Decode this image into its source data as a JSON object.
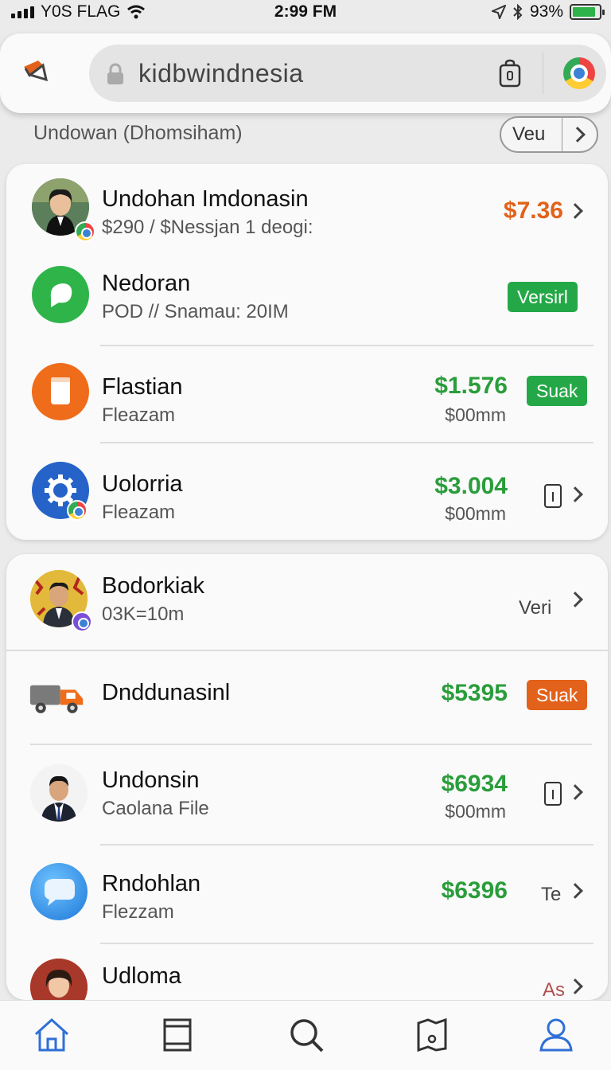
{
  "status_bar": {
    "carrier": "Y0S FLAG",
    "time": "2:99 FM",
    "battery": "93%"
  },
  "header": {
    "search_value": "kidbwindnesia",
    "icons": [
      "brand-icon",
      "lock-icon",
      "bag-icon",
      "chrome-icon"
    ]
  },
  "section": {
    "title": "Undowan (Dhomsiham)",
    "view_label": "Veu"
  },
  "card1": {
    "rows": [
      {
        "name": "Undohan Imdonasin",
        "sub": "$290 / $Nessjan 1 deogi:",
        "price": "$7.36"
      },
      {
        "name": "Nedoran",
        "sub": "POD // Snamau: 20IM",
        "badge": "Versirl"
      },
      {
        "name": "Flastian",
        "sub": "Fleazam",
        "price": "$1.576",
        "price_sub": "$00mm",
        "badge": "Suak"
      },
      {
        "name": "Uolorria",
        "sub": "Fleazam",
        "price": "$3.004",
        "price_sub": "$00mm"
      }
    ]
  },
  "card2": {
    "rows": [
      {
        "name": "Bodorkiak",
        "sub": "03K=10m",
        "label": "Veri"
      },
      {
        "name": "Dnddunasinl",
        "price": "$5395",
        "badge": "Suak"
      },
      {
        "name": "Undonsin",
        "sub": "Caolana File",
        "price": "$6934",
        "price_sub": "$00mm"
      },
      {
        "name": "Rndohlan",
        "sub": "Flezzam",
        "price": "$6396",
        "label": "Te"
      },
      {
        "name": "Udloma",
        "label": "As"
      }
    ]
  },
  "tab_bar": {
    "tabs": [
      "home-icon",
      "book-icon",
      "search-icon",
      "map-icon",
      "profile-icon"
    ],
    "active": "home-icon"
  },
  "colors": {
    "green": "#2a9d3b",
    "orange": "#e2621b",
    "accent_blue": "#2f6fd6"
  }
}
